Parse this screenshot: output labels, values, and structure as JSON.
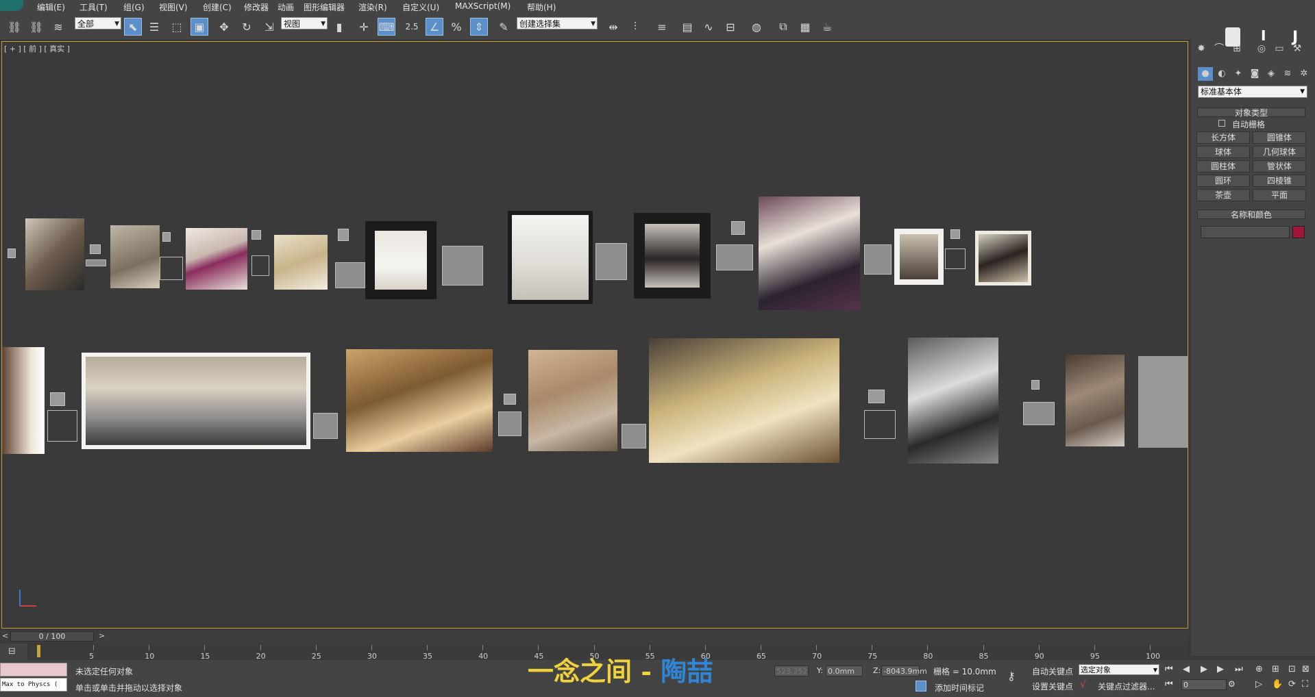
{
  "menu": [
    "编辑(E)",
    "工具(T)",
    "组(G)",
    "视图(V)",
    "创建(C)",
    "修改器",
    "动画",
    "图形编辑器",
    "渲染(R)",
    "自定义(U)",
    "MAXScript(M)",
    "帮助(H)"
  ],
  "toolbar": {
    "selection_filter": "全部",
    "reference_coord": "视图",
    "named_selection": "创建选择集",
    "snap_value": "2.5"
  },
  "viewport": {
    "label": "[ + ] [ 前 ] [ 真实 ]"
  },
  "command_panel": {
    "category": "标准基本体",
    "object_type_title": "对象类型",
    "autogrid": "自动栅格",
    "primitives": [
      "长方体",
      "圆锥体",
      "球体",
      "几何球体",
      "圆柱体",
      "管状体",
      "圆环",
      "四棱锥",
      "茶壶",
      "平面"
    ],
    "name_color_title": "名称和颜色",
    "color": "#a0163a"
  },
  "time": {
    "frame": "0 / 100",
    "ticks": [
      "5",
      "10",
      "15",
      "20",
      "25",
      "30",
      "35",
      "40",
      "45",
      "50",
      "55",
      "60",
      "65",
      "70",
      "75",
      "80",
      "85",
      "90",
      "95",
      "100"
    ]
  },
  "status": {
    "maxscript_label": "Max to Physcs (",
    "line1": "未选定任何对象",
    "line2": "单击或单击并拖动以选择对象",
    "x_value": "523.252",
    "y_label": "Y:",
    "y_value": "0.0mm",
    "z_label": "Z:",
    "z_value": "-8043.9mm",
    "grid": "栅格 = 10.0mm",
    "auto_key": "自动关键点",
    "set_key": "设置关键点",
    "key_mode": "选定对象",
    "key_filters": "关键点过滤器...",
    "add_time_tag": "添加时间标记",
    "frame_field": "0"
  },
  "caption": {
    "part1": "一念之间 - ",
    "part2": "陶喆"
  }
}
